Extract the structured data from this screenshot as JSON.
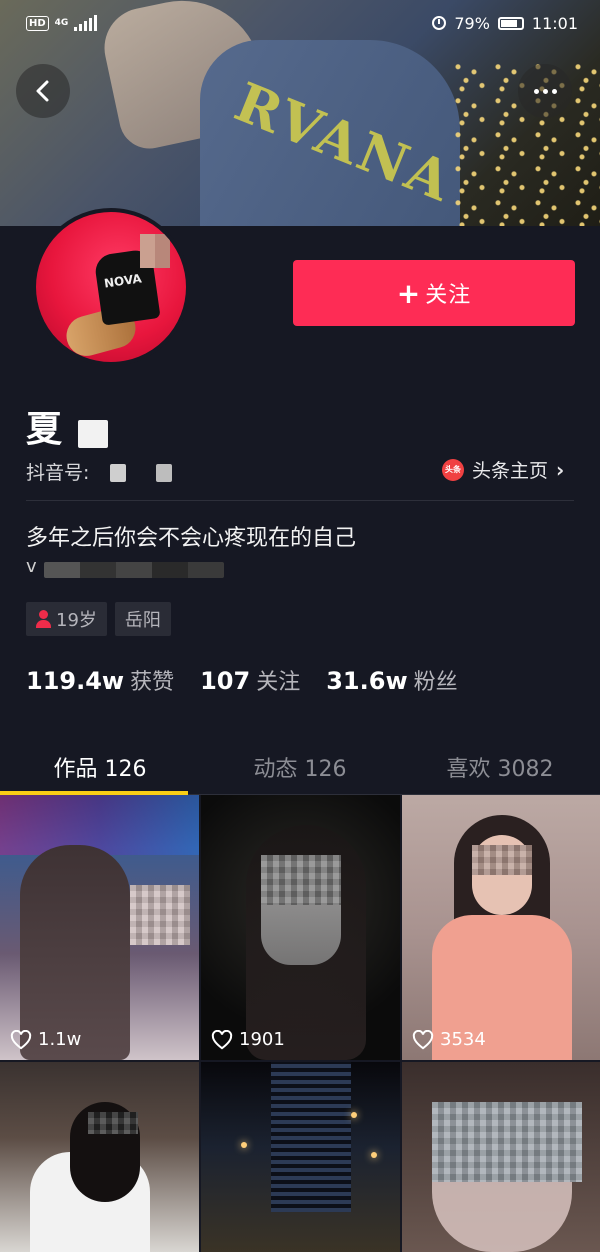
{
  "status_bar": {
    "hd": "HD",
    "network": "4G",
    "alarm": "alarm-icon",
    "battery_percent": "79%",
    "time": "11:01"
  },
  "profile": {
    "name": "夏",
    "douyin_id_label": "抖音号:",
    "follow_label": "关注",
    "toutiao_label": "头条主页",
    "toutiao_icon_text": "头条",
    "bio": "多年之后你会不会心疼现在的自己",
    "bio_line2": "v",
    "tags": [
      "19岁",
      "岳阳"
    ]
  },
  "stats": [
    {
      "value": "119.4w",
      "label": "获赞"
    },
    {
      "value": "107",
      "label": "关注"
    },
    {
      "value": "31.6w",
      "label": "粉丝"
    }
  ],
  "tabs": [
    {
      "label": "作品 126",
      "active": true
    },
    {
      "label": "动态 126",
      "active": false
    },
    {
      "label": "喜欢 3082",
      "active": false
    }
  ],
  "videos": [
    {
      "likes": "1.1w"
    },
    {
      "likes": "1901"
    },
    {
      "likes": "3534"
    },
    {
      "likes": ""
    },
    {
      "likes": ""
    },
    {
      "likes": ""
    }
  ],
  "colors": {
    "background": "#161823",
    "follow_button": "#fe2c55",
    "tab_indicator": "#face15",
    "muted_text": "#b5b5bb"
  },
  "cover_text": "RVANA"
}
